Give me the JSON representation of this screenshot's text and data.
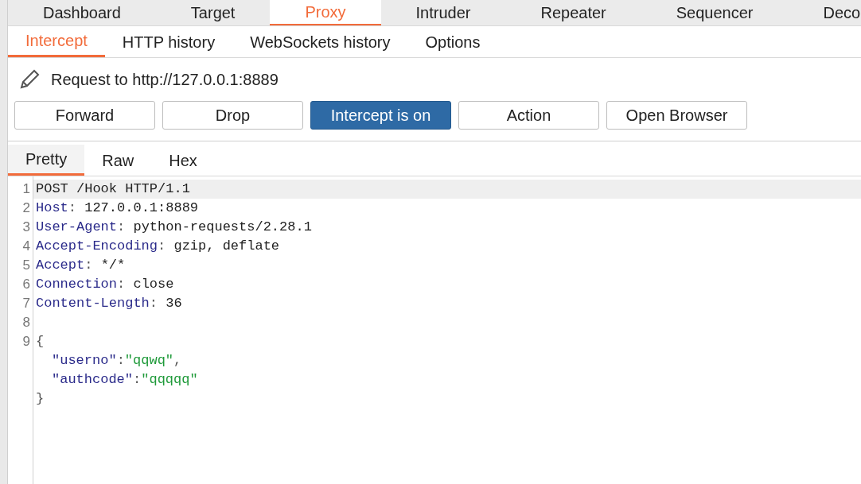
{
  "main_tabs": [
    {
      "label": "Dashboard",
      "selected": false
    },
    {
      "label": "Target",
      "selected": false
    },
    {
      "label": "Proxy",
      "selected": true
    },
    {
      "label": "Intruder",
      "selected": false
    },
    {
      "label": "Repeater",
      "selected": false
    },
    {
      "label": "Sequencer",
      "selected": false
    },
    {
      "label": "Deco",
      "selected": false
    }
  ],
  "sub_tabs": [
    {
      "label": "Intercept",
      "selected": true
    },
    {
      "label": "HTTP history",
      "selected": false
    },
    {
      "label": "WebSockets history",
      "selected": false
    },
    {
      "label": "Options",
      "selected": false
    }
  ],
  "request_title": "Request to http://127.0.0.1:8889",
  "buttons": [
    {
      "label": "Forward",
      "selected": false
    },
    {
      "label": "Drop",
      "selected": false
    },
    {
      "label": "Intercept is on",
      "selected": true
    },
    {
      "label": "Action",
      "selected": false
    },
    {
      "label": "Open Browser",
      "selected": false
    }
  ],
  "view_tabs": [
    {
      "label": "Pretty",
      "selected": true
    },
    {
      "label": "Raw",
      "selected": false
    },
    {
      "label": "Hex",
      "selected": false
    }
  ],
  "editor_lines": [
    {
      "number": "1",
      "highlighted": true,
      "tokens": [
        {
          "kind": "plain",
          "text": "POST /Hook HTTP/1.1"
        }
      ]
    },
    {
      "number": "2",
      "highlighted": false,
      "tokens": [
        {
          "kind": "header",
          "text": "Host"
        },
        {
          "kind": "punct",
          "text": ": "
        },
        {
          "kind": "plain",
          "text": "127.0.0.1:8889"
        }
      ]
    },
    {
      "number": "3",
      "highlighted": false,
      "tokens": [
        {
          "kind": "header",
          "text": "User-Agent"
        },
        {
          "kind": "punct",
          "text": ": "
        },
        {
          "kind": "plain",
          "text": "python-requests/2.28.1"
        }
      ]
    },
    {
      "number": "4",
      "highlighted": false,
      "tokens": [
        {
          "kind": "header",
          "text": "Accept-Encoding"
        },
        {
          "kind": "punct",
          "text": ": "
        },
        {
          "kind": "plain",
          "text": "gzip, deflate"
        }
      ]
    },
    {
      "number": "5",
      "highlighted": false,
      "tokens": [
        {
          "kind": "header",
          "text": "Accept"
        },
        {
          "kind": "punct",
          "text": ": "
        },
        {
          "kind": "plain",
          "text": "*/*"
        }
      ]
    },
    {
      "number": "6",
      "highlighted": false,
      "tokens": [
        {
          "kind": "header",
          "text": "Connection"
        },
        {
          "kind": "punct",
          "text": ": "
        },
        {
          "kind": "plain",
          "text": "close"
        }
      ]
    },
    {
      "number": "7",
      "highlighted": false,
      "tokens": [
        {
          "kind": "header",
          "text": "Content-Length"
        },
        {
          "kind": "punct",
          "text": ": "
        },
        {
          "kind": "plain",
          "text": "36"
        }
      ]
    },
    {
      "number": "8",
      "highlighted": false
    },
    {
      "number": "9",
      "highlighted": false,
      "tokens": [
        {
          "kind": "punct",
          "text": "{"
        }
      ]
    },
    {
      "highlighted": false,
      "indented": true,
      "tokens": [
        {
          "kind": "key",
          "text": "\"userno\""
        },
        {
          "kind": "punct",
          "text": ":"
        },
        {
          "kind": "string",
          "text": "\"qqwq\""
        },
        {
          "kind": "punct",
          "text": ","
        }
      ]
    },
    {
      "highlighted": false,
      "indented": true,
      "tokens": [
        {
          "kind": "key",
          "text": "\"authcode\""
        },
        {
          "kind": "punct",
          "text": ":"
        },
        {
          "kind": "string",
          "text": "\"qqqqq\""
        }
      ]
    },
    {
      "highlighted": false,
      "tokens": [
        {
          "kind": "punct",
          "text": "}"
        }
      ]
    }
  ]
}
